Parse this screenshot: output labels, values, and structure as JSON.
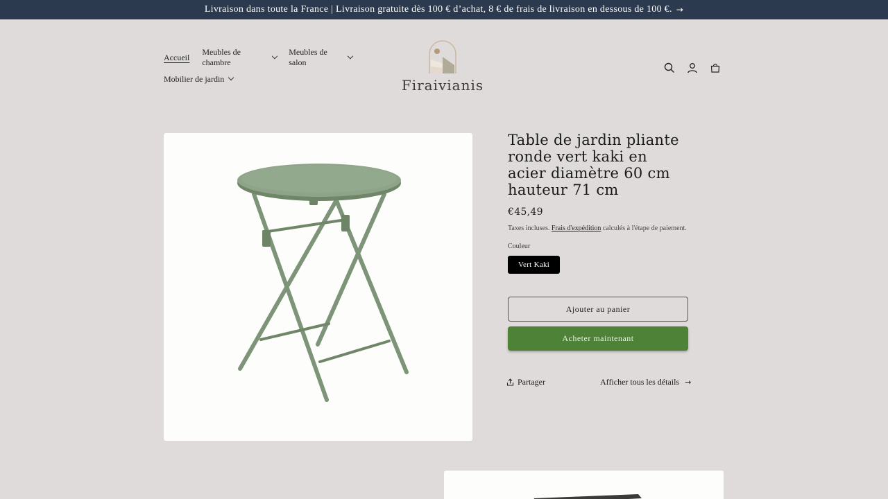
{
  "announcement": {
    "text": "Livraison dans toute la France | Livraison gratuite dès 100 € d’achat, 8 € de frais de livraison en dessous de 100 €.",
    "arrow": "→"
  },
  "nav": {
    "items": [
      {
        "label": "Accueil",
        "active": true
      },
      {
        "label": "Meubles de chambre",
        "dropdown": true
      },
      {
        "label": "Meubles de salon",
        "dropdown": true
      },
      {
        "label": "Mobilier de jardin",
        "dropdown": true
      }
    ]
  },
  "logo": {
    "text": "Firaivianis"
  },
  "header_icons": [
    "search-icon",
    "account-icon",
    "cart-icon"
  ],
  "product": {
    "title": "Table de jardin pliante ronde vert kaki en acier diamètre 60 cm hauteur 71 cm",
    "price": "€45,49",
    "tax_prefix": "Taxes incluses.",
    "tax_link": "Frais d'expédition",
    "tax_suffix": "calculés à l'étape de paiement.",
    "color_label": "Couleur",
    "color_value": "Vert Kaki",
    "add_to_cart": "Ajouter au panier",
    "buy_now": "Acheter maintenant",
    "share": "Partager",
    "details": "Afficher tous les détails",
    "details_arrow": "→"
  },
  "colors": {
    "announcement_bg": "#2b3a4f",
    "page_bg": "#e0dbdb",
    "buy_button": "#4e8236",
    "table_green": "#7d9478"
  }
}
